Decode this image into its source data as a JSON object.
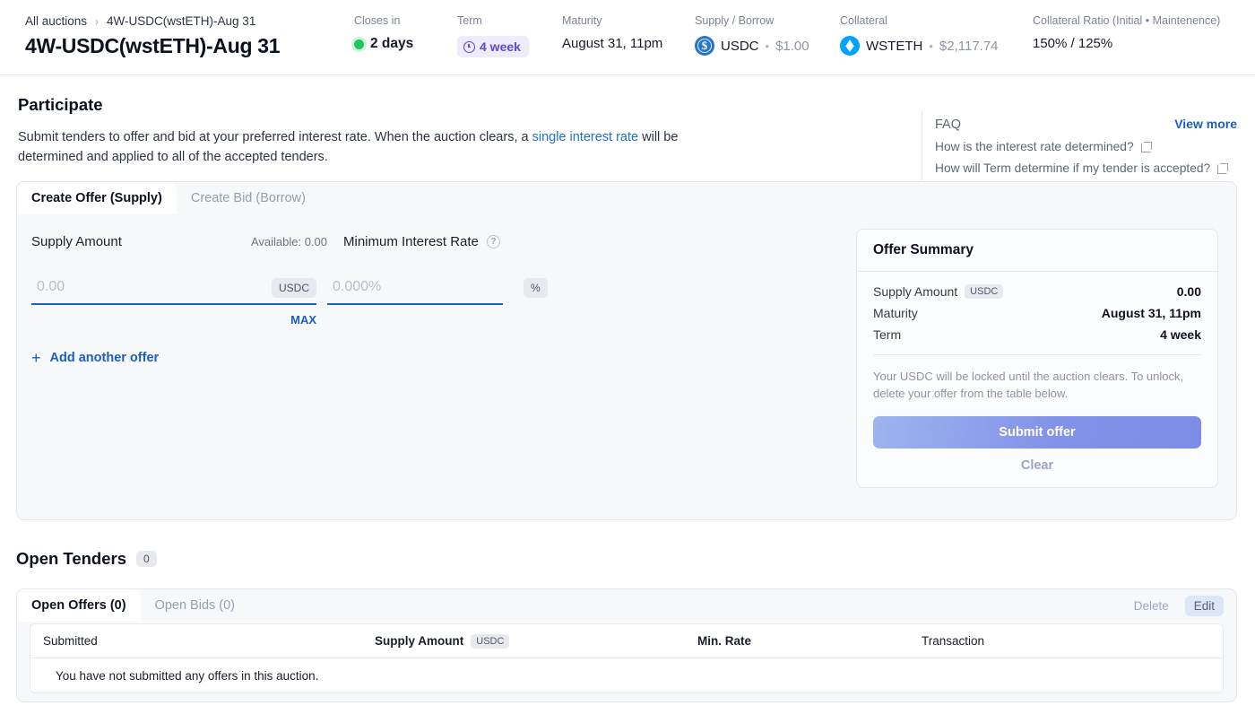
{
  "header": {
    "breadcrumb_root": "All auctions",
    "breadcrumb_sep": "›",
    "breadcrumb_current": "4W-USDC(wstETH)-Aug 31",
    "title": "4W-USDC(wstETH)-Aug 31",
    "stats": {
      "closes_in_label": "Closes in",
      "closes_in_value": "2 days",
      "term_label": "Term",
      "term_value": "4 week",
      "maturity_label": "Maturity",
      "maturity_value": "August 31, 11pm",
      "supply_borrow_label": "Supply / Borrow",
      "supply_borrow_symbol": "USDC",
      "supply_borrow_sep": "•",
      "supply_borrow_price": "$1.00",
      "collateral_label": "Collateral",
      "collateral_symbol": "WSTETH",
      "collateral_sep": "•",
      "collateral_price": "$2,117.74",
      "ratio_label": "Collateral Ratio (Initial • Maintenence)",
      "ratio_value": "150% / 125%"
    }
  },
  "participate": {
    "title": "Participate",
    "desc_part1": "Submit tenders to offer and bid at your preferred interest rate. When the auction clears, a ",
    "desc_link": "single interest rate",
    "desc_part2": " will be determined and applied to all of the accepted tenders."
  },
  "faq": {
    "title": "FAQ",
    "view_more": "View more",
    "items": [
      "How is the interest rate determined?",
      "How will Term determine if my tender is accepted?"
    ]
  },
  "offer_form": {
    "tab_offer": "Create Offer (Supply)",
    "tab_bid": "Create Bid (Borrow)",
    "supply_amount_label": "Supply Amount",
    "available_label": "Available: 0.00",
    "min_rate_label": "Minimum Interest Rate",
    "help_glyph": "?",
    "amount_value": "",
    "amount_placeholder": "0.00",
    "amount_unit": "USDC",
    "rate_value": "",
    "rate_placeholder": "0.000%",
    "rate_unit": "%",
    "max_label": "MAX",
    "add_offer_label": "Add another offer",
    "plus_glyph": "+"
  },
  "summary": {
    "title": "Offer Summary",
    "rows": [
      {
        "key": "Supply Amount",
        "pill": "USDC",
        "value": "0.00"
      },
      {
        "key": "Maturity",
        "pill": "",
        "value": "August 31, 11pm"
      },
      {
        "key": "Term",
        "pill": "",
        "value": "4 week"
      }
    ],
    "note": "Your USDC will be locked until the auction clears. To unlock, delete your offer from the table below.",
    "submit_label": "Submit offer",
    "clear_label": "Clear"
  },
  "tenders": {
    "title": "Open Tenders",
    "count": "0",
    "tab_offers": "Open Offers (0)",
    "tab_bids": "Open Bids (0)",
    "delete_label": "Delete",
    "edit_label": "Edit",
    "columns": {
      "submitted": "Submitted",
      "supply_amount": "Supply Amount",
      "supply_unit": "USDC",
      "min_rate": "Min. Rate",
      "transaction": "Transaction"
    },
    "empty_message": "You have not submitted any offers in this auction."
  }
}
